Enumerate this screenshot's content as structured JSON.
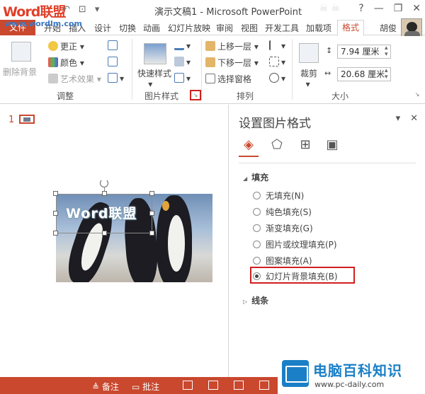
{
  "titlebar": {
    "logo_word": "Word",
    "logo_cn": "联盟",
    "logo_url": "www.wordlm.com",
    "app_title": "演示文稿1 - Microsoft PowerPoint",
    "help": "?",
    "minimize": "—",
    "restore": "❐",
    "close": "✕"
  },
  "tabs": {
    "file": "文件",
    "items": [
      "开始",
      "插入",
      "设计",
      "切换",
      "动画",
      "幻灯片放映",
      "审阅",
      "视图",
      "开发工具",
      "加载项"
    ],
    "active": "格式",
    "user": "胡俊"
  },
  "ribbon": {
    "adjust": {
      "remove_bg": "删除背景",
      "corrections": "更正",
      "color": "颜色",
      "artistic": "艺术效果",
      "label": "调整"
    },
    "picture_styles": {
      "quick_styles": "快速样式",
      "label": "图片样式"
    },
    "arrange": {
      "bring_forward": "上移一层",
      "send_backward": "下移一层",
      "selection_pane": "选择窗格",
      "label": "排列"
    },
    "size": {
      "crop": "裁剪",
      "height": "7.94 厘米",
      "width": "20.68 厘米",
      "label": "大小"
    }
  },
  "slides": {
    "number": "1"
  },
  "picture": {
    "watermark": "Word联盟"
  },
  "pane": {
    "title": "设置图片格式",
    "fill_section": "填充",
    "options": [
      {
        "label": "无填充(N)",
        "checked": false
      },
      {
        "label": "纯色填充(S)",
        "checked": false
      },
      {
        "label": "渐变填充(G)",
        "checked": false
      },
      {
        "label": "图片或纹理填充(P)",
        "checked": false
      },
      {
        "label": "图案填充(A)",
        "checked": false
      },
      {
        "label": "幻灯片背景填充(B)",
        "checked": true
      }
    ],
    "line_section": "线条"
  },
  "statusbar": {
    "notes": "备注",
    "comments": "批注"
  },
  "brand": {
    "title": "电脑百科知识",
    "url": "www.pc-daily.com"
  },
  "colors": {
    "accent": "#c9482e",
    "highlight": "#d01f1f",
    "brand_blue": "#1a7fc7"
  }
}
